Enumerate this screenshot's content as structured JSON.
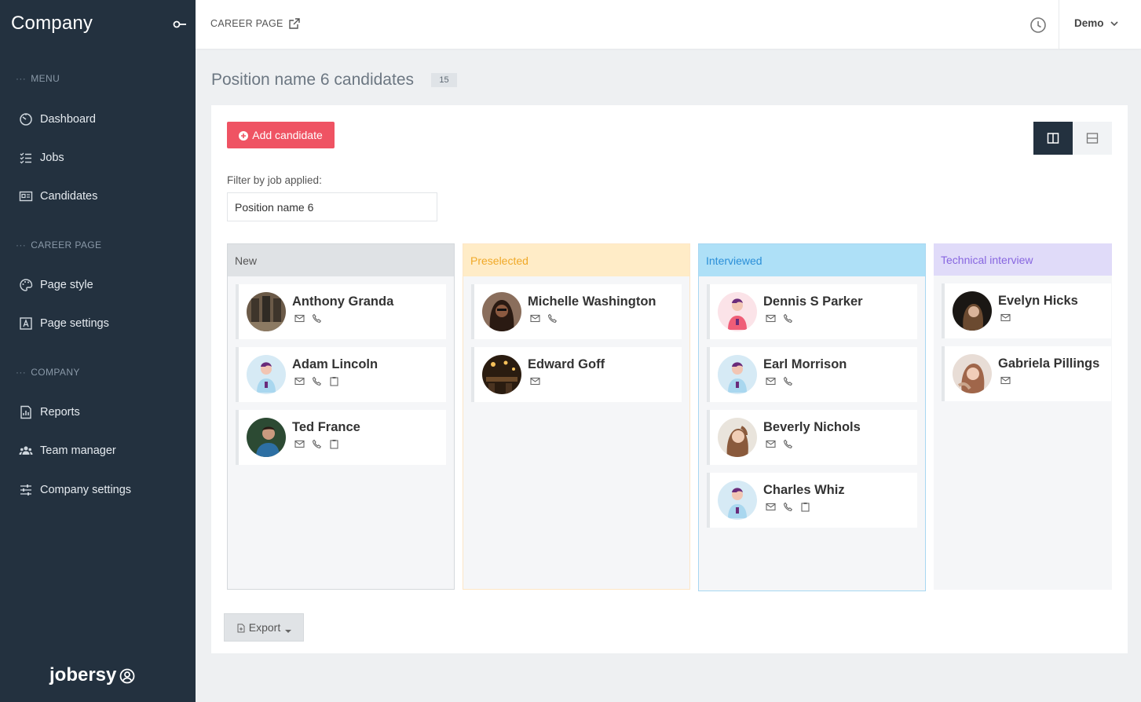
{
  "sidebar": {
    "brand": "Company",
    "sections": [
      {
        "label": "MENU"
      },
      {
        "label": "CAREER PAGE"
      },
      {
        "label": "COMPANY"
      }
    ],
    "items": [
      {
        "label": "Dashboard",
        "icon": "dashboard-icon"
      },
      {
        "label": "Jobs",
        "icon": "jobs-list-icon"
      },
      {
        "label": "Candidates",
        "icon": "id-card-icon"
      },
      {
        "label": "Page style",
        "icon": "palette-icon"
      },
      {
        "label": "Page settings",
        "icon": "font-settings-icon"
      },
      {
        "label": "Reports",
        "icon": "reports-icon"
      },
      {
        "label": "Team manager",
        "icon": "team-icon"
      },
      {
        "label": "Company settings",
        "icon": "sliders-icon"
      }
    ],
    "footer_logo": "jobersy"
  },
  "topbar": {
    "career_link": "CAREER PAGE",
    "user": "Demo"
  },
  "page": {
    "title": "Position name 6 candidates",
    "count": "15"
  },
  "toolbar": {
    "add_label": "Add candidate",
    "filter_label": "Filter by job applied:",
    "filter_value": "Position name 6",
    "export_label": "Export"
  },
  "columns": [
    {
      "title": "New",
      "candidates": [
        {
          "name": "Anthony Granda",
          "icons": [
            "mail",
            "phone"
          ]
        },
        {
          "name": "Adam Lincoln",
          "icons": [
            "mail",
            "phone",
            "clipboard"
          ]
        },
        {
          "name": "Ted France",
          "icons": [
            "mail",
            "phone",
            "clipboard"
          ]
        }
      ]
    },
    {
      "title": "Preselected",
      "candidates": [
        {
          "name": "Michelle Washington",
          "icons": [
            "mail",
            "phone"
          ]
        },
        {
          "name": "Edward Goff",
          "icons": [
            "mail"
          ]
        }
      ]
    },
    {
      "title": "Interviewed",
      "candidates": [
        {
          "name": "Dennis S Parker",
          "icons": [
            "mail",
            "phone"
          ]
        },
        {
          "name": "Earl Morrison",
          "icons": [
            "mail",
            "phone"
          ]
        },
        {
          "name": "Beverly Nichols",
          "icons": [
            "mail",
            "phone"
          ]
        },
        {
          "name": "Charles Whiz",
          "icons": [
            "mail",
            "phone",
            "clipboard"
          ]
        }
      ]
    },
    {
      "title": "Technical interview",
      "candidates": [
        {
          "name": "Evelyn Hicks",
          "icons": [
            "mail"
          ]
        },
        {
          "name": "Gabriela Pillings",
          "icons": [
            "mail"
          ]
        }
      ]
    }
  ],
  "colors": {
    "sidebar_bg": "#23313f",
    "accent_red": "#ef5363",
    "new": "#dfe2e5",
    "preselected": "#ffecc7",
    "interviewed": "#aee0f7",
    "technical": "#e0dbf9"
  }
}
